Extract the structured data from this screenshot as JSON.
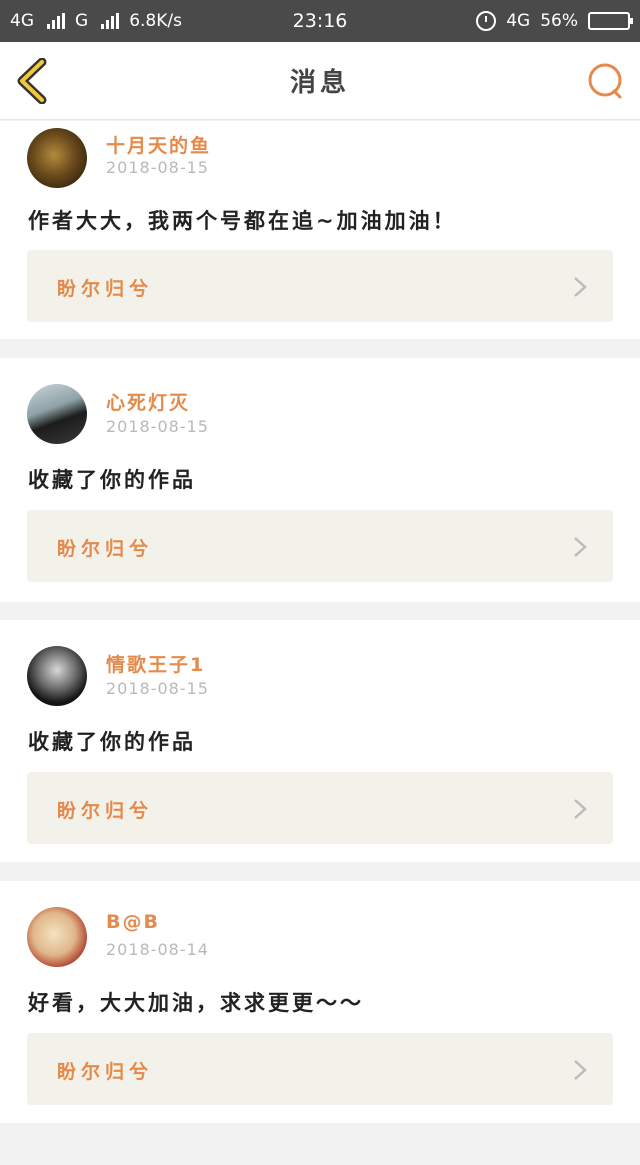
{
  "status_bar": {
    "network1": "4G",
    "network2": "G",
    "speed": "6.8K/s",
    "time": "23:16",
    "network3": "4G",
    "battery": "56%",
    "battery_level": 0.56
  },
  "nav": {
    "title": "消息",
    "back_icon": "chevron-left-icon",
    "search_icon": "search-icon",
    "accent": "#e58a4a"
  },
  "messages": [
    {
      "user": "十月天的鱼",
      "date": "2018-08-15",
      "text": "作者大大，我两个号都在追~加油加油！",
      "work": "盼尔归兮"
    },
    {
      "user": "心死灯灭",
      "date": "2018-08-15",
      "text": "收藏了你的作品",
      "work": "盼尔归兮"
    },
    {
      "user": "情歌王子1",
      "date": "2018-08-15",
      "text": "收藏了你的作品",
      "work": "盼尔归兮"
    },
    {
      "user": "B@B",
      "date": "2018-08-14",
      "text": "好看，大大加油，求求更更～～",
      "work": "盼尔归兮"
    }
  ]
}
